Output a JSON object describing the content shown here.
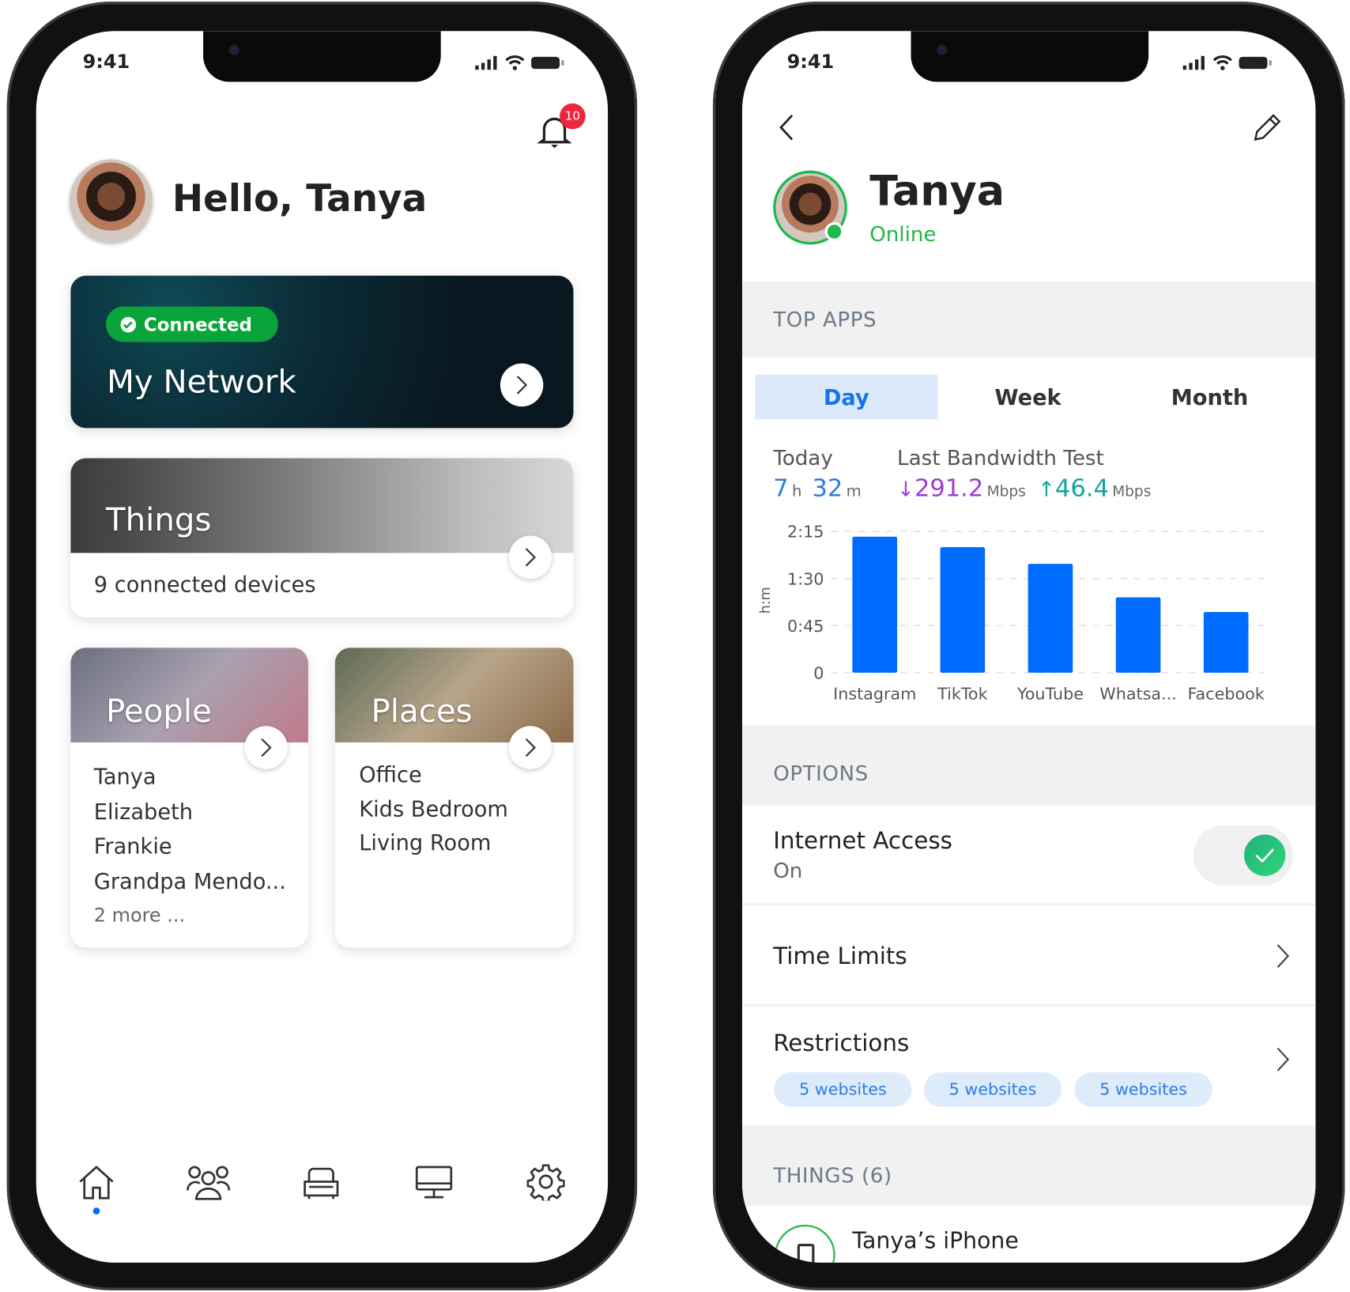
{
  "status_bar": {
    "time": "9:41"
  },
  "home": {
    "notification_count": "10",
    "greeting": "Hello, Tanya",
    "network_card": {
      "badge": "Connected",
      "title": "My Network"
    },
    "things_card": {
      "title": "Things",
      "subtitle": "9 connected devices"
    },
    "people_card": {
      "title": "People",
      "items": [
        "Tanya",
        "Elizabeth",
        "Frankie",
        "Grandpa Mendo..."
      ],
      "more": "2 more ..."
    },
    "places_card": {
      "title": "Places",
      "items": [
        "Office",
        "Kids Bedroom",
        "Living Room"
      ]
    },
    "bottom_nav": [
      {
        "icon": "home-icon",
        "active": true
      },
      {
        "icon": "people-icon"
      },
      {
        "icon": "couch-icon"
      },
      {
        "icon": "monitor-icon"
      },
      {
        "icon": "gear-icon"
      }
    ]
  },
  "profile": {
    "name": "Tanya",
    "status": "Online",
    "top_apps_header": "TOP APPS",
    "tabs": [
      "Day",
      "Week",
      "Month"
    ],
    "active_tab": "Day",
    "today_label": "Today",
    "today_hours": "7",
    "today_h_unit": "h",
    "today_minutes": "32",
    "today_m_unit": "m",
    "bandwidth_label": "Last Bandwidth Test",
    "download": "291.2",
    "upload": "46.4",
    "unit": "Mbps",
    "options_header": "OPTIONS",
    "internet_access": {
      "title": "Internet Access",
      "value": "On",
      "enabled": true
    },
    "time_limits": "Time Limits",
    "restrictions": {
      "title": "Restrictions",
      "pills": [
        "5 websites",
        "5 websites",
        "5 websites"
      ]
    },
    "things_header": "THINGS (6)",
    "things_first": "Tanya’s iPhone"
  },
  "colors": {
    "accent": "#006cff",
    "online": "#1fb84a",
    "connected": "#0aa53a",
    "download": "#a13ad6",
    "upload": "#14a3a3",
    "badge": "#f0263a"
  },
  "chart_data": {
    "type": "bar",
    "categories": [
      "Instagram",
      "TikTok",
      "YouTube",
      "Whatsa...",
      "Facebook"
    ],
    "values": [
      "2:10",
      "2:00",
      "1:44",
      "1:12",
      "0:58"
    ],
    "ylabel": "h:m",
    "yticks": [
      "0",
      "0:45",
      "1:30",
      "2:15"
    ],
    "ylim": [
      "0",
      "2:15"
    ],
    "grid": true
  }
}
